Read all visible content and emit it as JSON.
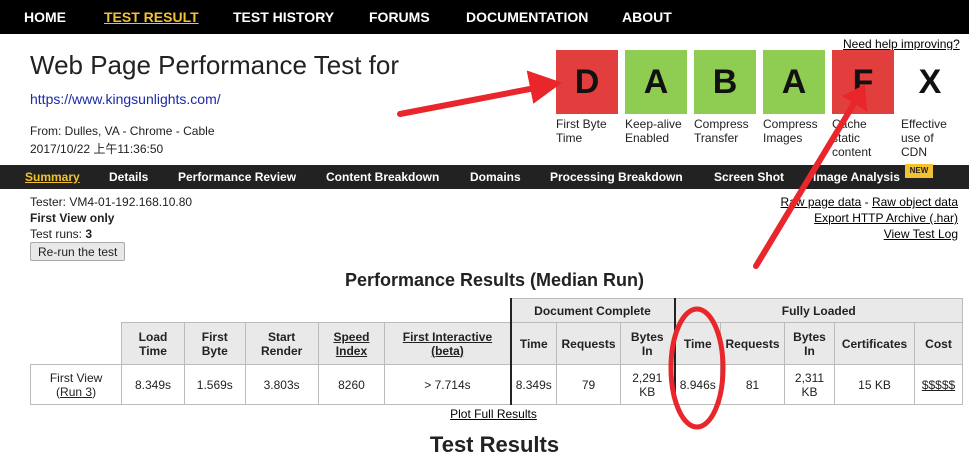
{
  "nav": {
    "items": [
      "HOME",
      "TEST RESULT",
      "TEST HISTORY",
      "FORUMS",
      "DOCUMENTATION",
      "ABOUT"
    ]
  },
  "help_link": "Need help improving?",
  "header": {
    "title": "Web Page Performance Test for",
    "url": "https://www.kingsunlights.com/",
    "from_label": "From: Dulles, VA - Chrome - Cable",
    "date": "2017/10/22 上午11:36:50"
  },
  "grades": [
    {
      "letter": "D",
      "label_line1": "First Byte",
      "label_line2": "Time",
      "label_line3": "",
      "color": "#e33e3e"
    },
    {
      "letter": "A",
      "label_line1": "Keep-alive",
      "label_line2": "Enabled",
      "label_line3": "",
      "color": "#8fcc52"
    },
    {
      "letter": "B",
      "label_line1": "Compress",
      "label_line2": "Transfer",
      "label_line3": "",
      "color": "#8fcc52"
    },
    {
      "letter": "A",
      "label_line1": "Compress",
      "label_line2": "Images",
      "label_line3": "",
      "color": "#8fcc52"
    },
    {
      "letter": "F",
      "label_line1": "Cache",
      "label_line2": "static",
      "label_line3": "content",
      "color": "#e33e3e"
    },
    {
      "letter": "X",
      "label_line1": "Effective",
      "label_line2": "use of",
      "label_line3": "CDN",
      "color": "#ffffff"
    }
  ],
  "subnav": {
    "items": [
      "Summary",
      "Details",
      "Performance Review",
      "Content Breakdown",
      "Domains",
      "Processing Breakdown",
      "Screen Shot",
      "Image Analysis"
    ],
    "new_badge": "NEW"
  },
  "test_info": {
    "tester": "Tester: VM4-01-192.168.10.80",
    "first_view_only": "First View only",
    "runs_label": "Test runs: ",
    "runs_value": "3",
    "rerun_button": "Re-run the test"
  },
  "right_links": {
    "raw_page_data": "Raw page data",
    "separator": " - ",
    "raw_object_data": "Raw object data",
    "export_har": "Export HTTP Archive (.har)",
    "view_log": "View Test Log"
  },
  "performance_section": {
    "title": "Performance Results (Median Run)",
    "group_headers": {
      "document_complete": "Document Complete",
      "fully_loaded": "Fully Loaded"
    },
    "columns": {
      "load_time": [
        "Load",
        "Time"
      ],
      "first_byte": [
        "First",
        "Byte"
      ],
      "start_render": [
        "Start",
        "Render"
      ],
      "speed_index": [
        "Speed",
        "Index"
      ],
      "first_interactive": [
        "First Interactive",
        "(beta)"
      ],
      "dc_time": "Time",
      "dc_requests": "Requests",
      "dc_bytes": [
        "Bytes",
        "In"
      ],
      "fl_time": "Time",
      "fl_requests": "Requests",
      "fl_bytes": [
        "Bytes",
        "In"
      ],
      "certificates": "Certificates",
      "cost": "Cost"
    },
    "row": {
      "label": "First View",
      "run_open": "(",
      "run_link": "Run 3",
      "run_close": ")",
      "load_time": "8.349s",
      "first_byte": "1.569s",
      "start_render": "3.803s",
      "speed_index": "8260",
      "first_interactive": "> 7.714s",
      "dc_time": "8.349s",
      "dc_requests": "79",
      "dc_bytes_1": "2,291",
      "dc_bytes_2": "KB",
      "fl_time": "8.946s",
      "fl_requests": "81",
      "fl_bytes_1": "2,311",
      "fl_bytes_2": "KB",
      "certificates": "15 KB",
      "cost": "$$$$$"
    },
    "plot_link": "Plot Full Results"
  },
  "test_results_title": "Test Results",
  "annotation_color": "#e8262b"
}
